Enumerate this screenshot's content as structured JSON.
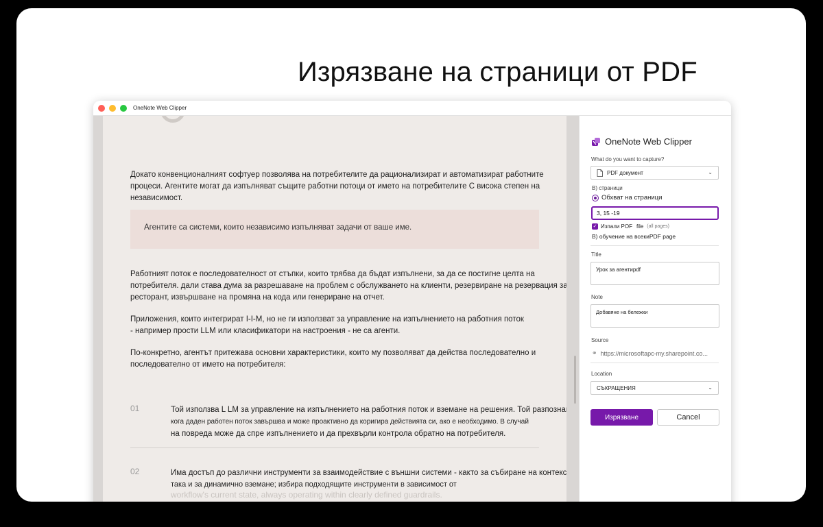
{
  "hero": {
    "title": "Изрязване на страници от PDF"
  },
  "window": {
    "title": "OneNote Web Clipper"
  },
  "document": {
    "paragraph1": "Докато конвенционалният софтуер позволява на потребителите да рационализират и автоматизират работните процеси. Агентите могат да изпълняват същите работни потоци от името на потребителите С висока степен на независимост.",
    "quote": "Агентите са системи, които независимо изпълняват задачи от ваше име.",
    "paragraph2": "Работният поток е последователност от стъпки, които трябва да бъдат изпълнени, за да се постигне целта на потребителя. дали става дума за разрешаване на проблем с обслужването на клиенти, резервиране на резервация за ресторант, извършване на промяна на кода или генериране на отчет.",
    "paragraph3a": "Приложения, които интегрират I-I-M, но не ги използват за управление на изпълнението на работния поток",
    "paragraph3b": "- например прости LLM или класификатори на настроения - не са агенти.",
    "paragraph4": "По-конкретно, агентът притежава основни характеристики, които му позволяват да действа последователно и последователно от името на потребителя:",
    "list": [
      {
        "num": "01",
        "line1": "Той използва L LM за управление на изпълнението на работния поток и вземане на решения. Той разпознава",
        "line2": "кога даден работен поток завършва и може проактивно да коригира действията си, ако е необходимо. В случай",
        "line3": "на повреда може да спре изпълнението и да прехвърли контрола обратно на потребителя."
      },
      {
        "num": "02",
        "line1": "Има достъп до различни инструменти за взаимодействие с външни системи - както за събиране на контекст,",
        "line2": "така и за динамично вземане; избира подходящите инструменти в зависимост от",
        "line3": "workflow's current state, always operating within clearly defined guardrails."
      }
    ]
  },
  "panel": {
    "title": "OneNote Web Clipper",
    "capture_label": "What do you want to capture?",
    "capture_value": "PDF документ",
    "pages_label": "В) страници",
    "range_option": "Обхват на страници",
    "range_value": "3, 15 -19",
    "attach_label": "Изпали POF",
    "attach_file": "file",
    "attach_sub": "(all pages)",
    "every_label_a": "В) обучение на всеки",
    "every_label_b": "PDF page",
    "title_label": "Title",
    "title_value": "Урок за агентиpdf",
    "note_label": "Note",
    "note_placeholder": "Добавяне на бележки",
    "source_label": "Source",
    "source_value": "https://microsoftapc-my.sharepoint.co...",
    "location_label": "Location",
    "location_value": "СЪКРАЩЕНИЯ",
    "clip_button": "Изрязване",
    "cancel_button": "Cancel"
  },
  "colors": {
    "accent": "#7719aa",
    "quote_bg": "#ecdeda",
    "page_bg": "#efebe8"
  }
}
